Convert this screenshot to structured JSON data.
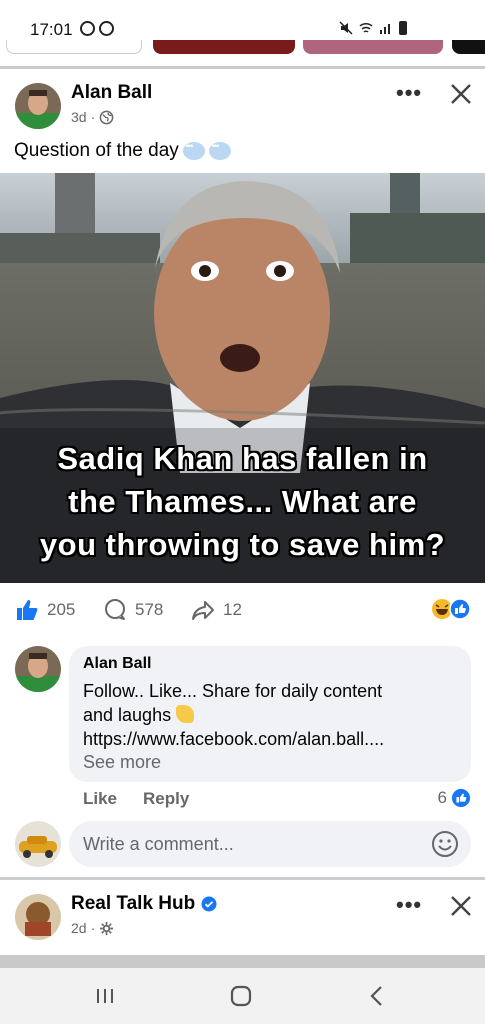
{
  "status_bar": {
    "time": "17:01"
  },
  "post1": {
    "author": "Alan Ball",
    "time_ago": "3d",
    "audience_icon": "globe-icon",
    "caption": "Question of the day",
    "meme_lines": [
      "Sadiq Khan has fallen in",
      "the Thames... What are",
      "you throwing to save him?"
    ],
    "reactions": {
      "likes": "205",
      "comments": "578",
      "shares": "12"
    },
    "top_comment": {
      "author": "Alan Ball",
      "text_line1": "Follow.. Like... Share for daily content",
      "text_line2": "and laughs",
      "text_line3": "https://www.facebook.com/alan.ball....",
      "see_more": "See more",
      "like_label": "Like",
      "reply_label": "Reply",
      "like_count": "6"
    },
    "write_comment_placeholder": "Write a comment..."
  },
  "post2": {
    "author": "Real Talk Hub",
    "verified": true,
    "time_ago": "2d",
    "audience_icon": "gear-icon"
  },
  "colors": {
    "facebook_blue": "#1877f2",
    "secondary_text": "#65676b",
    "comment_bg": "#f0f2f5"
  }
}
